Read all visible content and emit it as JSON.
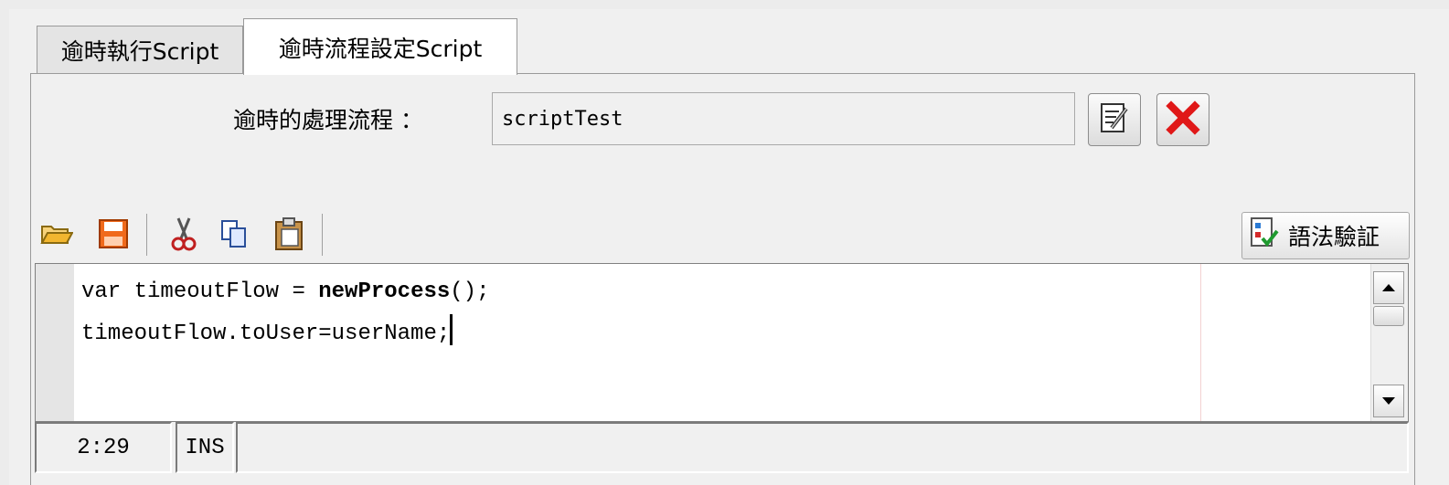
{
  "tabs": [
    {
      "label": "逾時執行Script",
      "active": false
    },
    {
      "label": "逾時流程設定Script",
      "active": true
    }
  ],
  "flow": {
    "label": "逾時的處理流程 ：",
    "value": "scriptTest"
  },
  "toolbar": {
    "icons": [
      "open-folder-icon",
      "save-icon",
      "cut-icon",
      "copy-icon",
      "paste-icon"
    ],
    "verify_label": "語法驗証"
  },
  "editor": {
    "line1_pre": "var timeoutFlow = ",
    "line1_kw": "newProcess",
    "line1_post": "();",
    "line2": "timeoutFlow.toUser=userName;"
  },
  "status": {
    "position": "2:29",
    "mode": "INS",
    "message": ""
  },
  "colors": {
    "delete_red": "#e01818",
    "folder_yellow": "#f2b630",
    "save_orange": "#f06a1c"
  }
}
